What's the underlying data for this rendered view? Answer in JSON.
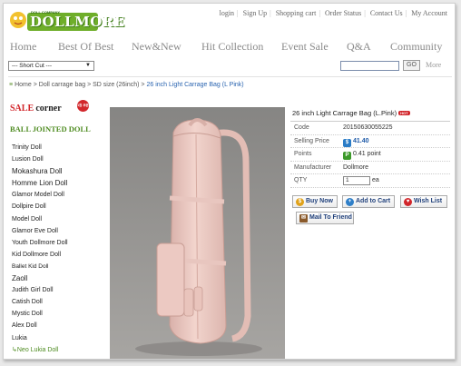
{
  "header": {
    "logo_text": "DOLLMORE",
    "logo_sub": "DOLL COMPANY",
    "top_links": [
      "login",
      "Sign Up",
      "Shopping cart",
      "Order Status",
      "Contact Us",
      "My Account"
    ],
    "nav": [
      "Home",
      "Best Of Best",
      "New&New",
      "Hit Collection",
      "Event Sale",
      "Q&A",
      "Community"
    ],
    "shortcut_value": "--- Short Cut ---",
    "search_value": "",
    "go_label": "GO",
    "more_label": "More"
  },
  "breadcrumb": {
    "items": [
      "Home",
      "Doll carrage bag",
      "SD size (26inch)"
    ],
    "current": "26 inch Light Carrage Bag (L Pink)"
  },
  "sidebar": {
    "sale_red": "SALE",
    "sale_black": "corner",
    "sale_badge": "1원 쿠폰",
    "category_title": "BALL JOINTED DOLL",
    "items": [
      "Trinity  Doll",
      "Lusion Doll",
      "Mokashura Doll",
      "Homme Lion Doll",
      "Glamor Model Doll",
      "Dollpire Doll",
      "Model Doll",
      "Glamor Eve Doll",
      "Youth Dollmore Doll",
      "Kid Dollmore Doll",
      "Ballet Kid Doll",
      "Zaoll",
      "Judith Girl Doll",
      "Catish Doll",
      "Mystic Doll",
      "Alex Doll",
      "Lukia",
      "Neo Lukia Doll"
    ],
    "active_index": 17
  },
  "product": {
    "title": "26 inch Light Carrage Bag (L.Pink)",
    "hot_label": "HOT",
    "rows": {
      "code_label": "Code",
      "code": "20150630055225",
      "price_label": "Selling Price",
      "price": "41.40",
      "price_icon": "$",
      "points_label": "Points",
      "points": "0.41 point",
      "points_icon": "P",
      "maker_label": "Manufacturer",
      "maker": "Dollmore",
      "qty_label": "QTY",
      "qty": "1",
      "qty_unit": "ea"
    },
    "buttons": {
      "buy": "Buy Now",
      "cart": "Add to Cart",
      "wish": "Wish List",
      "mail": "Mail To Friend"
    }
  },
  "colors": {
    "brand_green": "#4f8c22",
    "sale_red": "#d2262b",
    "link_blue": "#2a64b0",
    "bag_pink": "#ecc9c2"
  }
}
